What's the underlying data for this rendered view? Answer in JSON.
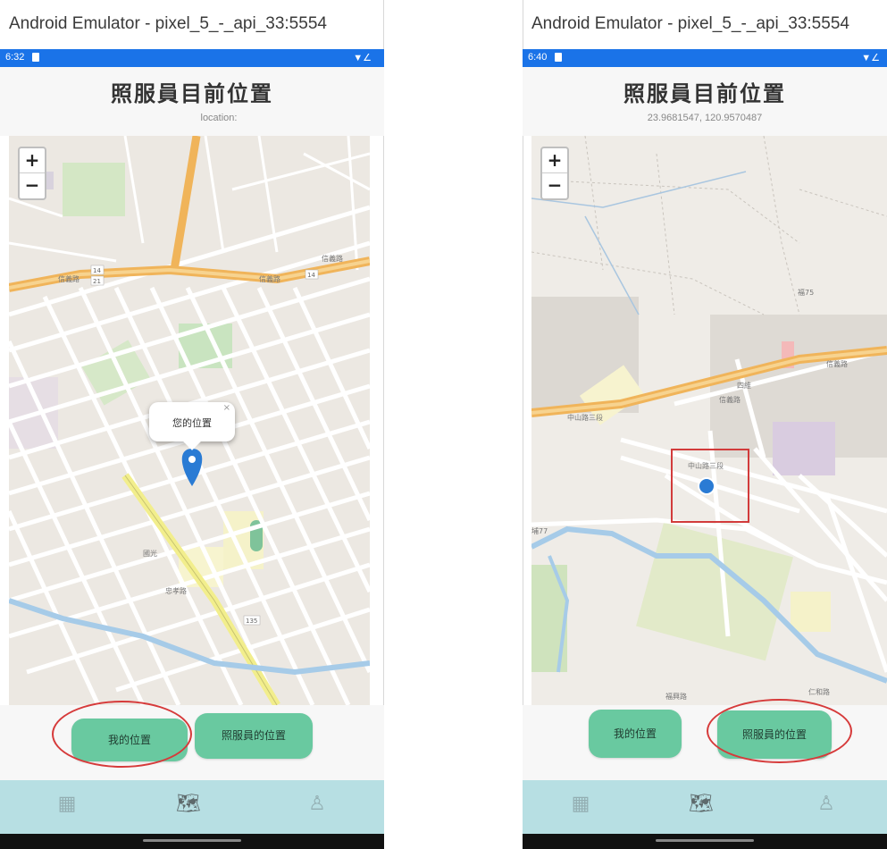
{
  "left": {
    "window_title": "Android Emulator - pixel_5_-_api_33:5554",
    "status_time": "6:32",
    "app_title": "照服員目前位置",
    "location_text": "location:",
    "popup_text": "您的位置",
    "popup_close": "×",
    "zoom_in": "+",
    "zoom_out": "−",
    "btn_my_location": "我的位置",
    "btn_caregiver_location": "照服員的位置",
    "map_labels": [
      "信義路",
      "信義路",
      "14",
      "21",
      "14",
      "135",
      "國光",
      "忠孝路"
    ]
  },
  "right": {
    "window_title": "Android Emulator - pixel_5_-_api_33:5554",
    "status_time": "6:40",
    "app_title": "照服員目前位置",
    "location_text": "23.9681547, 120.9570487",
    "zoom_in": "+",
    "zoom_out": "−",
    "btn_my_location": "我的位置",
    "btn_caregiver_location": "照服員的位置",
    "map_labels": [
      "信義路",
      "中山路三段",
      "福興",
      "仁和路",
      "埔77"
    ]
  },
  "colors": {
    "status_bar": "#1a73e8",
    "button": "#69c9a0",
    "nav_bar": "#b7dfe3",
    "marker": "#2a7bd4",
    "highlight": "#d23b3b"
  },
  "icons": {
    "nav_left": "dashboard-icon",
    "nav_center": "map-pin-icon",
    "nav_right": "user-icon",
    "marker_left": "map-marker-icon",
    "marker_right": "location-dot-icon"
  }
}
